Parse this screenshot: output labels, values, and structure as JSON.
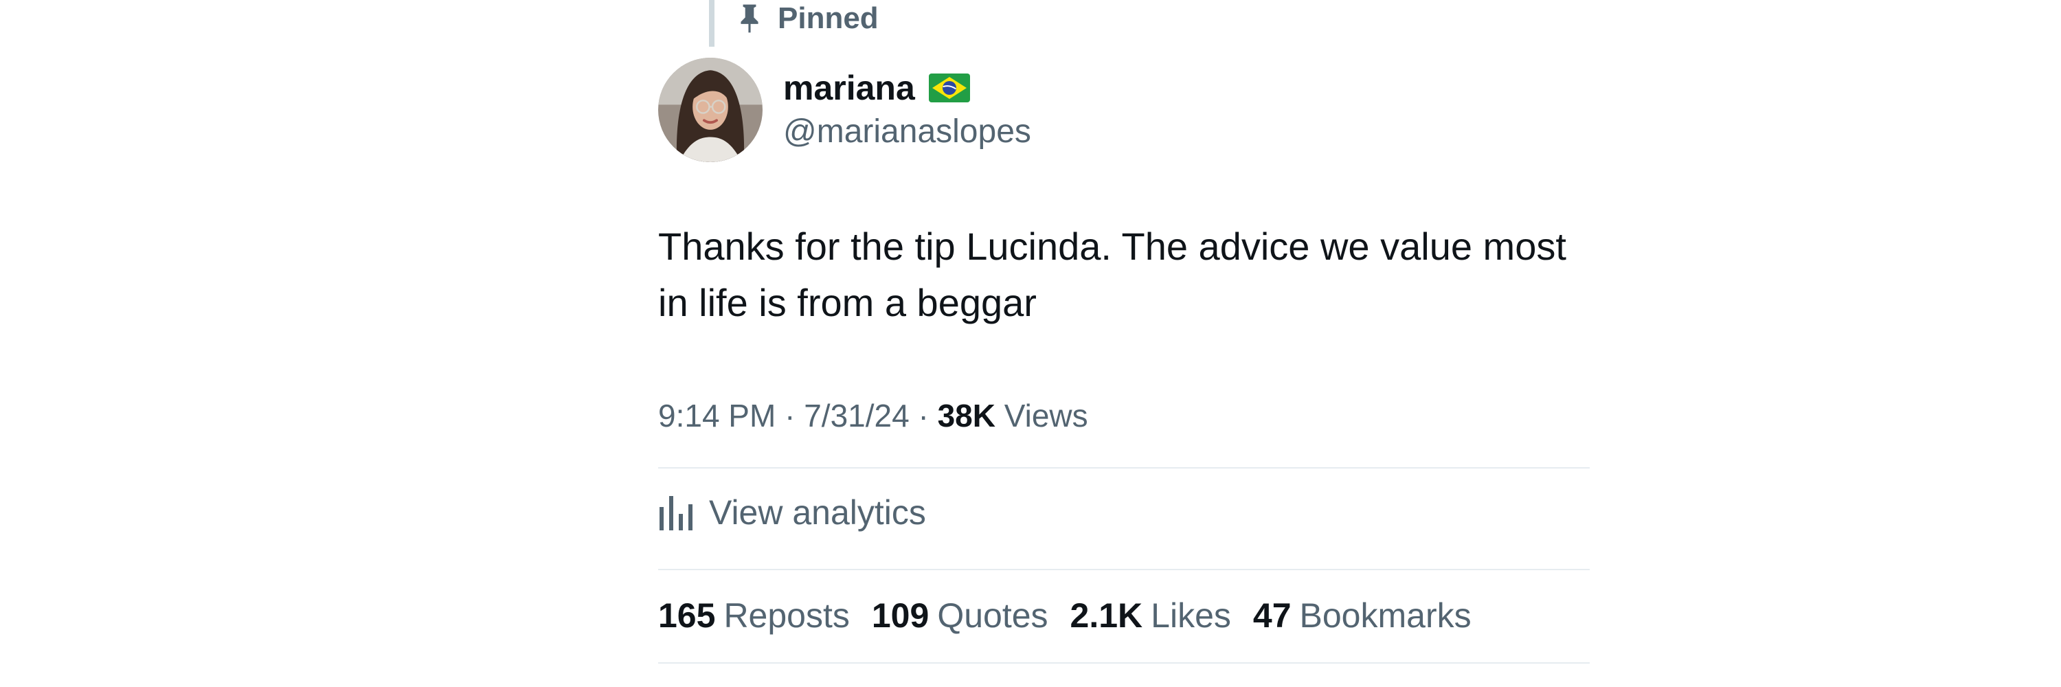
{
  "pinned_label": "Pinned",
  "user": {
    "display_name": "mariana",
    "handle": "@marianaslopes",
    "flag_icon": "brazil-flag-icon"
  },
  "tweet": {
    "text": "Thanks for the tip Lucinda. The advice we value most in life is from a beggar"
  },
  "meta": {
    "time": "9:14 PM",
    "separator": "·",
    "date": "7/31/24",
    "views_count": "38K",
    "views_label": "Views"
  },
  "analytics": {
    "label": "View analytics",
    "icon": "analytics-icon"
  },
  "stats": [
    {
      "count": "165",
      "label": "Reposts"
    },
    {
      "count": "109",
      "label": "Quotes"
    },
    {
      "count": "2.1K",
      "label": "Likes"
    },
    {
      "count": "47",
      "label": "Bookmarks"
    }
  ],
  "colors": {
    "primary_text": "#0f1419",
    "secondary_text": "#536471",
    "divider": "#e6ecf0",
    "thread_line": "#cfd9de"
  }
}
